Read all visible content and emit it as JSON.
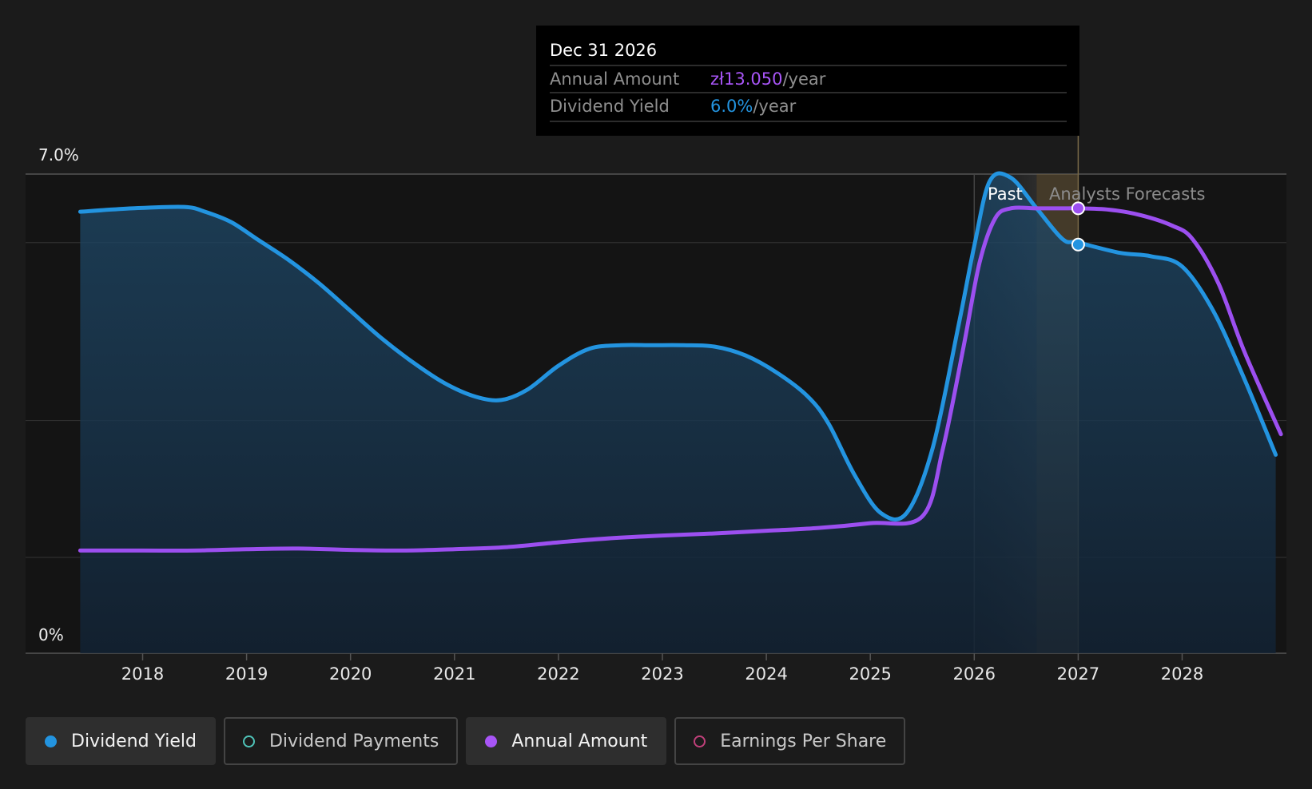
{
  "chart_data": {
    "type": "area",
    "x_axis": {
      "ticks": [
        "2018",
        "2019",
        "2020",
        "2021",
        "2022",
        "2023",
        "2024",
        "2025",
        "2026",
        "2027",
        "2028"
      ]
    },
    "y_axis": {
      "top_label": "7.0%",
      "bottom_label": "0%",
      "range": [
        0,
        7.0
      ],
      "unit": "%"
    },
    "grid": true,
    "series": [
      {
        "name": "Dividend Yield",
        "color": "#2394e0",
        "filled": true,
        "points": [
          [
            2017.4,
            6.45
          ],
          [
            2017.9,
            6.5
          ],
          [
            2018.4,
            6.52
          ],
          [
            2018.6,
            6.45
          ],
          [
            2018.85,
            6.3
          ],
          [
            2019.1,
            6.05
          ],
          [
            2019.4,
            5.75
          ],
          [
            2019.7,
            5.4
          ],
          [
            2020.0,
            5.0
          ],
          [
            2020.3,
            4.6
          ],
          [
            2020.6,
            4.25
          ],
          [
            2020.9,
            3.95
          ],
          [
            2021.2,
            3.75
          ],
          [
            2021.45,
            3.7
          ],
          [
            2021.7,
            3.85
          ],
          [
            2022.0,
            4.2
          ],
          [
            2022.3,
            4.45
          ],
          [
            2022.6,
            4.5
          ],
          [
            2022.9,
            4.5
          ],
          [
            2023.2,
            4.5
          ],
          [
            2023.5,
            4.48
          ],
          [
            2023.8,
            4.35
          ],
          [
            2024.1,
            4.1
          ],
          [
            2024.4,
            3.75
          ],
          [
            2024.6,
            3.35
          ],
          [
            2024.85,
            2.6
          ],
          [
            2025.1,
            2.05
          ],
          [
            2025.35,
            2.05
          ],
          [
            2025.6,
            3.0
          ],
          [
            2025.85,
            4.8
          ],
          [
            2026.0,
            5.95
          ],
          [
            2026.15,
            6.9
          ],
          [
            2026.35,
            6.95
          ],
          [
            2026.6,
            6.5
          ],
          [
            2026.85,
            6.05
          ],
          [
            2027.0,
            6.0
          ],
          [
            2027.4,
            5.85
          ],
          [
            2027.7,
            5.8
          ],
          [
            2028.0,
            5.65
          ],
          [
            2028.3,
            5.0
          ],
          [
            2028.6,
            4.0
          ],
          [
            2028.9,
            2.9
          ]
        ]
      },
      {
        "name": "Annual Amount",
        "color": "#9c4ff0",
        "filled": false,
        "points": [
          [
            2017.4,
            1.5
          ],
          [
            2018.0,
            1.5
          ],
          [
            2018.5,
            1.5
          ],
          [
            2019.0,
            1.52
          ],
          [
            2019.5,
            1.53
          ],
          [
            2020.0,
            1.51
          ],
          [
            2020.5,
            1.5
          ],
          [
            2021.0,
            1.52
          ],
          [
            2021.5,
            1.55
          ],
          [
            2022.0,
            1.62
          ],
          [
            2022.5,
            1.68
          ],
          [
            2023.0,
            1.72
          ],
          [
            2023.5,
            1.75
          ],
          [
            2024.0,
            1.79
          ],
          [
            2024.5,
            1.83
          ],
          [
            2025.0,
            1.9
          ],
          [
            2025.5,
            2.0
          ],
          [
            2025.7,
            3.0
          ],
          [
            2025.9,
            4.5
          ],
          [
            2026.05,
            5.7
          ],
          [
            2026.2,
            6.35
          ],
          [
            2026.35,
            6.5
          ],
          [
            2026.6,
            6.5
          ],
          [
            2026.85,
            6.5
          ],
          [
            2027.0,
            6.5
          ],
          [
            2027.3,
            6.48
          ],
          [
            2027.6,
            6.4
          ],
          [
            2027.9,
            6.25
          ],
          [
            2028.1,
            6.05
          ],
          [
            2028.35,
            5.4
          ],
          [
            2028.6,
            4.4
          ],
          [
            2028.95,
            3.2
          ]
        ]
      }
    ],
    "past_label": "Past",
    "forecast_label": "Analysts Forecasts",
    "past_end": 2026.0,
    "highlight": {
      "start": 2026.6,
      "end": 2027.0
    },
    "marker_x": 2027.0,
    "markers": [
      {
        "series": "Annual Amount",
        "x": 2027.0,
        "y": 6.5,
        "color": "#9c4ff0"
      },
      {
        "series": "Dividend Yield",
        "x": 2027.0,
        "y": 5.97,
        "color": "#2394e0"
      }
    ]
  },
  "tooltip": {
    "date": "Dec 31 2026",
    "rows": [
      {
        "label": "Annual Amount",
        "value": "zł13.050",
        "unit": "/year",
        "color": "#a855f7"
      },
      {
        "label": "Dividend Yield",
        "value": "6.0%",
        "unit": "/year",
        "color": "#2394e0"
      }
    ]
  },
  "legend": [
    {
      "label": "Dividend Yield",
      "color": "#2394e0",
      "filled": true,
      "active": true
    },
    {
      "label": "Dividend Payments",
      "color": "#4fc3b8",
      "filled": false,
      "active": false
    },
    {
      "label": "Annual Amount",
      "color": "#a855f7",
      "filled": true,
      "active": true
    },
    {
      "label": "Earnings Per Share",
      "color": "#c0407a",
      "filled": false,
      "active": false
    }
  ]
}
